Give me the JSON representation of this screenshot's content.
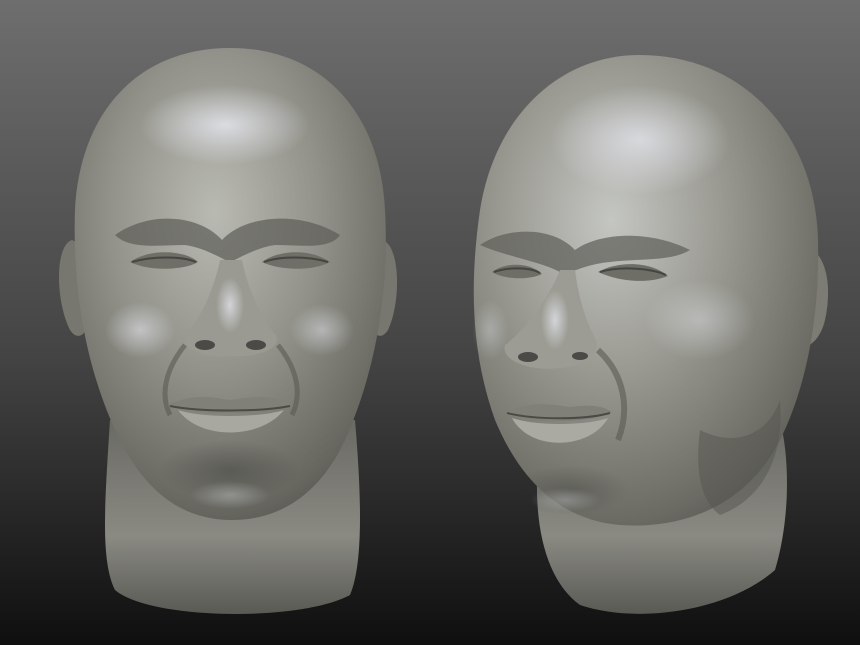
{
  "scene": {
    "views": [
      {
        "id": "front",
        "pose": "front"
      },
      {
        "id": "three-quarter",
        "pose": "three-quarter-left"
      }
    ]
  },
  "colors": {
    "background_top": "#6e6e6e",
    "background_bottom": "#0f0f0f",
    "clay_light": "#bfbfb4",
    "clay_mid": "#8c8c84",
    "clay_dark": "#4e4e4a",
    "highlight": "#e6e8ef"
  }
}
